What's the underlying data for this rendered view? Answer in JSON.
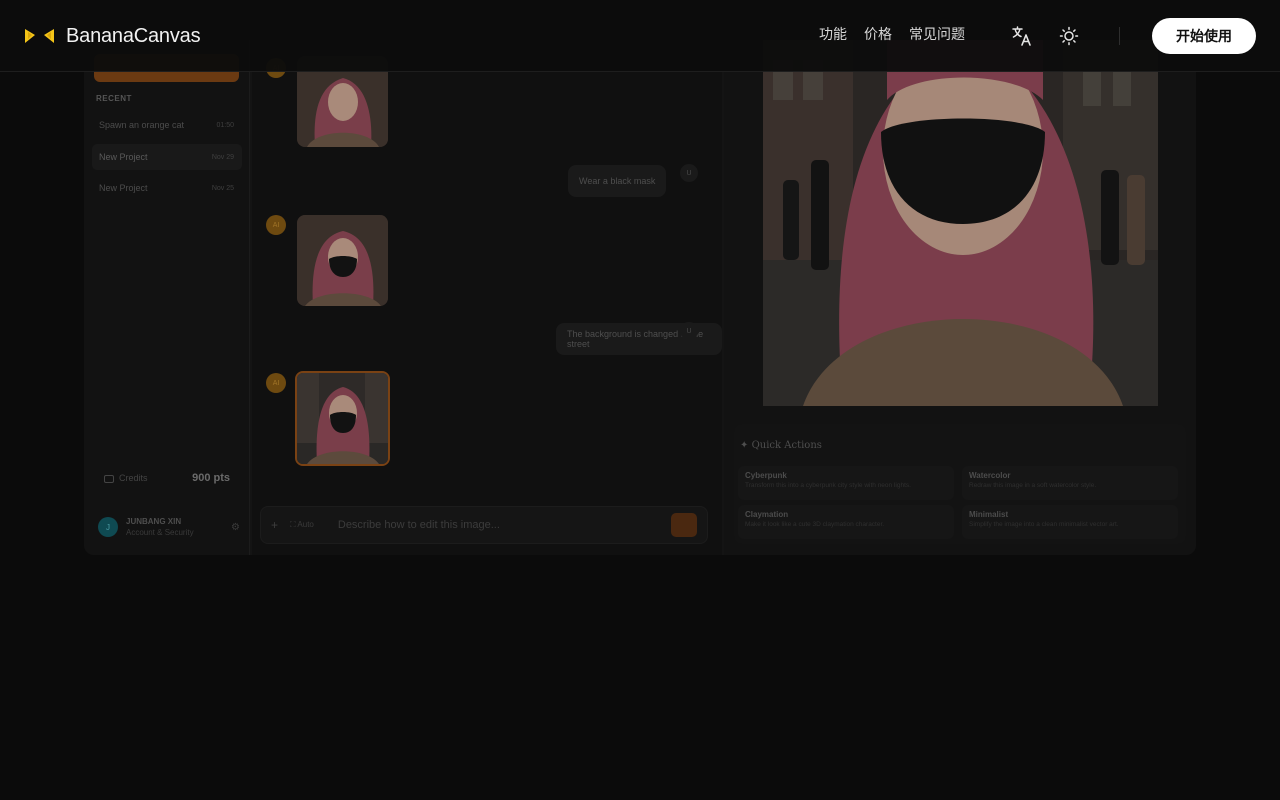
{
  "header": {
    "brand": "BananaCanvas",
    "nav": [
      "功能",
      "价格",
      "常见问题"
    ],
    "cta_label": "开始使用",
    "icons": [
      "translate-icon",
      "sun-icon"
    ]
  },
  "sidebar": {
    "recent_label": "RECENT",
    "items": [
      {
        "label": "Spawn an orange cat",
        "date": "01:50"
      },
      {
        "label": "New Project",
        "date": "Nov 29"
      },
      {
        "label": "New Project",
        "date": "Nov 25"
      }
    ],
    "credits_label": "Credits",
    "credits_value": "900 pts",
    "user": {
      "initial": "J",
      "name": "JUNBANG XIN",
      "sub": "Account & Security"
    }
  },
  "chat": {
    "ai_initials": "AI",
    "user_initial": "U",
    "messages": [
      "Wear a black mask",
      "The background is changed to the street"
    ],
    "composer": {
      "auto_label": "Auto",
      "placeholder": "Describe how to edit this image..."
    }
  },
  "quick_actions": {
    "title": "Quick Actions",
    "items": [
      {
        "title": "Cyberpunk",
        "desc": "Transform this into a cyberpunk city style with neon lights."
      },
      {
        "title": "Watercolor",
        "desc": "Redraw this image in a soft watercolor style."
      },
      {
        "title": "Claymation",
        "desc": "Make it look like a cute 3D claymation character."
      },
      {
        "title": "Minimalist",
        "desc": "Simplify the image into a clean minimalist vector art."
      }
    ]
  },
  "colors": {
    "background": "#0b0b0b",
    "accent": "#f5c518",
    "cta_bg": "#ffffff"
  }
}
